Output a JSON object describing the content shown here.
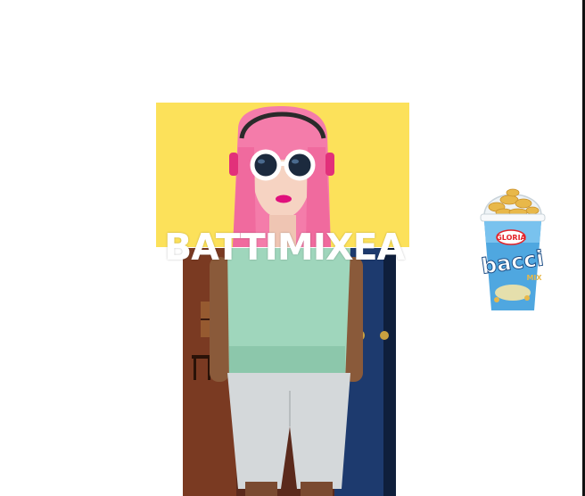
{
  "headline": {
    "text": "BATTIMIXEA"
  },
  "hero_image": {
    "subject": "pink-haired woman wearing round sunglasses and headphones",
    "background_color": "#FCE15A",
    "hair_color": "#F47CAA"
  },
  "person_image": {
    "subject": "person in mint green top and white capri pants"
  },
  "product_image": {
    "brand": "GLORIA",
    "name": "bacci",
    "sub": "MIX",
    "label_color": "#4FA7E0",
    "brand_color": "#E32228"
  },
  "colors": {
    "page_background": "#FFFFFF",
    "headline_color": "#FFFFFF",
    "edge_bar": "#111111"
  }
}
